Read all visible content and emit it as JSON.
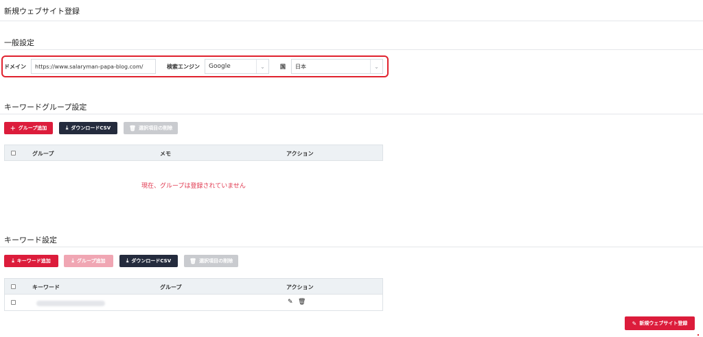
{
  "page": {
    "title": "新規ウェブサイト登録"
  },
  "general": {
    "title": "一般設定",
    "domain_label": "ドメイン",
    "domain_value": "https://www.salaryman-papa-blog.com/",
    "engine_label": "検索エンジン",
    "engine_value": "Google",
    "country_label": "国",
    "country_value": "日本"
  },
  "group_settings": {
    "title": "キーワードグループ設定",
    "add_group_label": "グループ追加",
    "download_csv_label": "ダウンロードCSV",
    "delete_selected_label": "選択項目の削除",
    "columns": [
      "グループ",
      "メモ",
      "アクション"
    ],
    "empty_message": "現在、グループは登録されていません"
  },
  "keyword_settings": {
    "title": "キーワード設定",
    "add_keyword_label": "キーワード追加",
    "add_group_label": "グループ追加",
    "download_csv_label": "ダウンロードCSV",
    "delete_selected_label": "選択項目の削除",
    "columns": [
      "キーワード",
      "グループ",
      "アクション"
    ]
  },
  "footer": {
    "register_label": "新規ウェブサイト登録"
  },
  "colors": {
    "primary": "#dc1c3b",
    "dark": "#242b3d",
    "disabled": "#c9cbcf",
    "highlight": "#e0202c"
  },
  "icons": {
    "add": "plus-icon",
    "download": "download-icon",
    "delete": "trash-icon",
    "edit": "pencil-icon",
    "register": "edit-square-icon",
    "chevron": "chevron-down-icon"
  }
}
